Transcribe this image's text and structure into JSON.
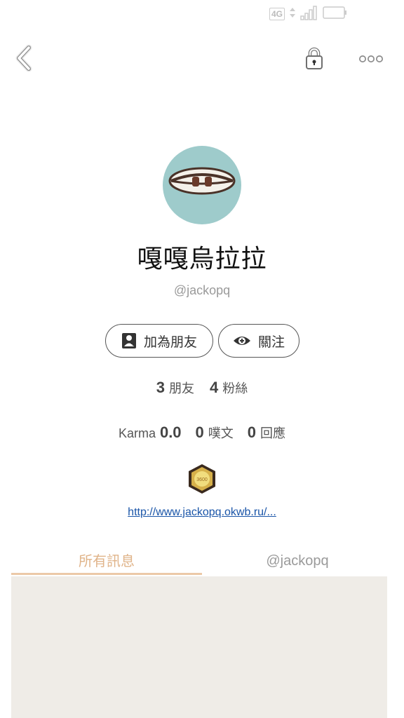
{
  "status_bar": {
    "network": "4G"
  },
  "profile": {
    "display_name": "嘎嘎烏拉拉",
    "handle": "@jackopq"
  },
  "actions": {
    "add_friend_label": "加為朋友",
    "follow_label": "關注"
  },
  "stats": {
    "friends_count": "3",
    "friends_label": "朋友",
    "fans_count": "4",
    "fans_label": "粉絲",
    "karma_label": "Karma",
    "karma_value": "0.0",
    "posts_count": "0",
    "posts_label": "噗文",
    "replies_count": "0",
    "replies_label": "回應"
  },
  "badge": {
    "text": "3600"
  },
  "link": {
    "text": "http://www.jackopq.okwb.ru/..."
  },
  "tabs": [
    {
      "label": "所有訊息"
    },
    {
      "label": "@jackopq"
    }
  ],
  "colors": {
    "avatar_bg": "#9ecbcb",
    "active_tab": "#e0b48a",
    "link": "#1a55a8",
    "content_bg": "#efece7"
  }
}
